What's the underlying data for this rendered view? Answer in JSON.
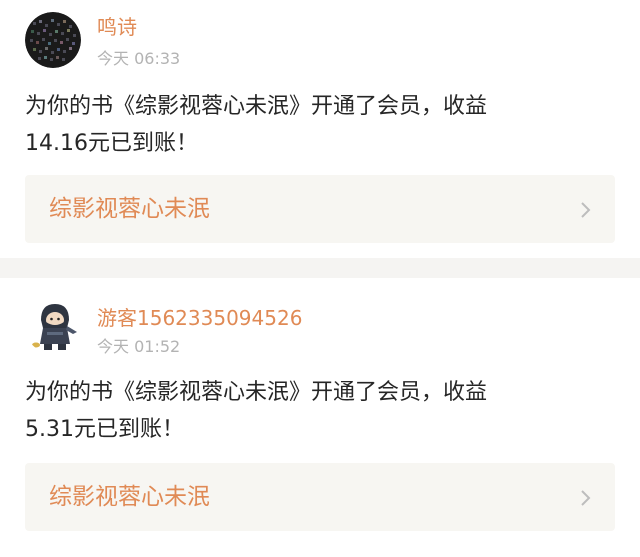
{
  "notifications": [
    {
      "avatar_icon": "dark-mosaic-avatar",
      "username": "鸣诗",
      "time": "今天 06:33",
      "message_line1": "为你的书《综影视蓉心未泯》开通了会员，收益",
      "message_line2": "14.16元已到账！",
      "book_title": "综影视蓉心未泯",
      "chevron_icon": "chevron-right-icon"
    },
    {
      "avatar_icon": "ninja-character-avatar",
      "username": "游客1562335094526",
      "time": "今天 01:52",
      "message_line1": "为你的书《综影视蓉心未泯》开通了会员，收益",
      "message_line2": "5.31元已到账！",
      "book_title": "综影视蓉心未泯",
      "chevron_icon": "chevron-right-icon"
    }
  ],
  "colors": {
    "accent": "#e08a55",
    "time_gray": "#b3b3b3",
    "page_bg": "#f5f4f2",
    "link_bg": "#f7f6f2"
  }
}
